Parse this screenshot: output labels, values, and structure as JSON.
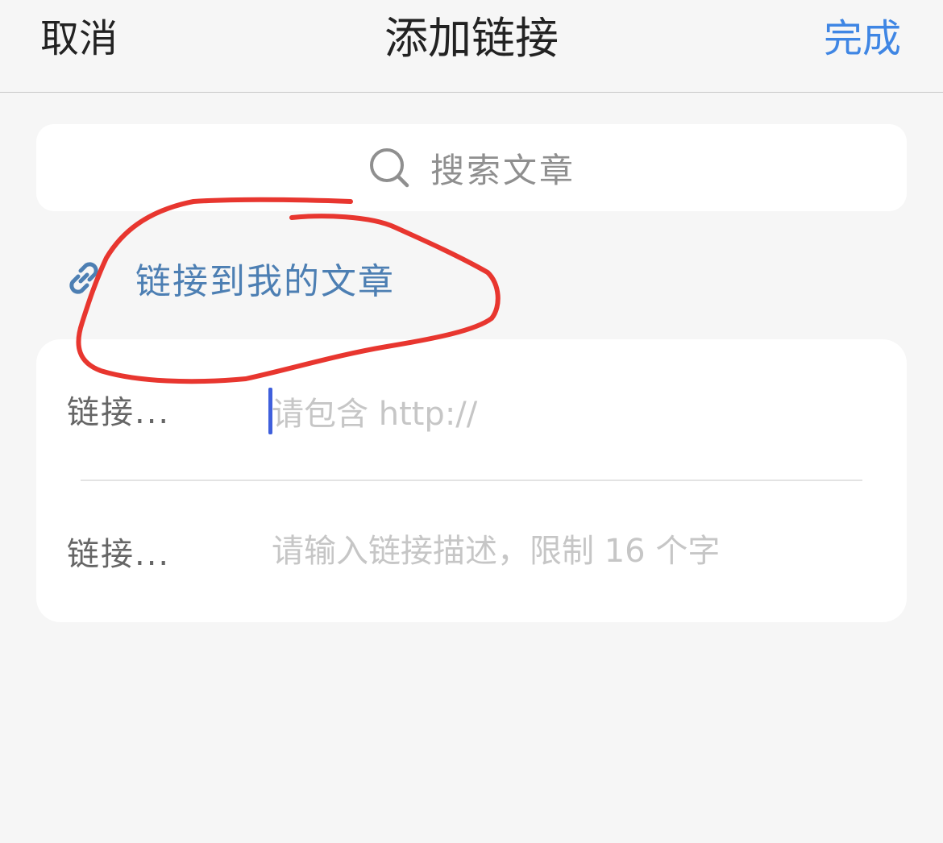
{
  "navbar": {
    "cancel_label": "取消",
    "title": "添加链接",
    "done_label": "完成",
    "done_color": "#3f86e4"
  },
  "search": {
    "icon": "search-icon",
    "placeholder": "搜索文章"
  },
  "my_articles": {
    "icon": "link-icon",
    "label": "链接到我的文章",
    "color": "#4d7fb3"
  },
  "form": {
    "url_field": {
      "label": "链接...",
      "value": "",
      "placeholder": "请包含 http://"
    },
    "description_field": {
      "label": "链接...",
      "value": "",
      "placeholder": "请输入链接描述，限制 16 个字"
    }
  },
  "annotation": {
    "type": "hand-drawn-circle",
    "color": "#e8362f"
  }
}
